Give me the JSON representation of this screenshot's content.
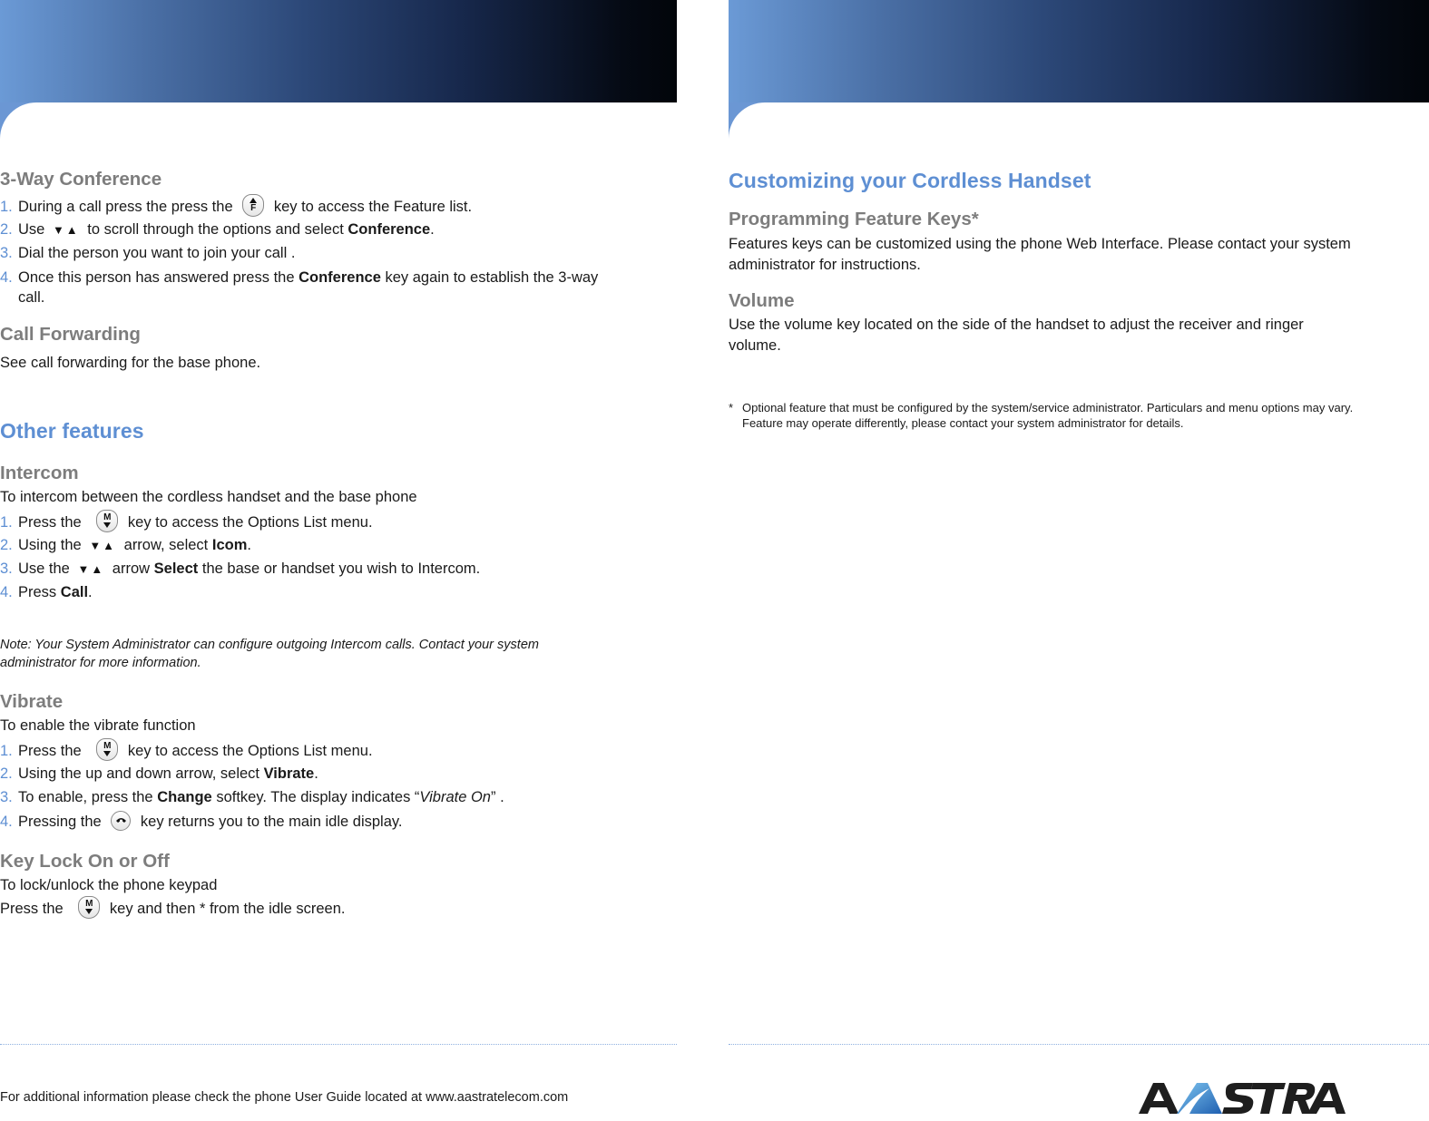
{
  "colors": {
    "accent": "#5e8fd3",
    "subheading": "#7d7d7d",
    "body": "#1a1a1a",
    "banner_start": "#6b9ad6",
    "banner_end": "#02050a"
  },
  "left": {
    "conference": {
      "title": "3-Way Conference",
      "steps": [
        {
          "num": "1.",
          "a": "During a call press the press the",
          "icon": "feature-key-icon",
          "icon_label": "F",
          "b": "key to access the Feature list."
        },
        {
          "num": "2.",
          "a": "Use",
          "arrows": "▼▲",
          "b": "to scroll through the options and select",
          "bold": "Conference",
          "c": "."
        },
        {
          "num": "3.",
          "a": "Dial the person you want to join your call ."
        },
        {
          "num": "4.",
          "a": "Once this person has answered press the",
          "bold": "Conference",
          "b": "key again to establish the 3-way",
          "cont": "call."
        }
      ]
    },
    "call_forwarding": {
      "title": "Call Forwarding",
      "text": "See call forwarding for the base phone."
    },
    "other_features": {
      "title": "Other features"
    },
    "intercom": {
      "title": "Intercom",
      "intro": "To intercom between the cordless handset and the base phone",
      "steps": [
        {
          "num": "1.",
          "a": "Press the",
          "icon": "menu-key-icon",
          "icon_label": "M",
          "b": "key to access the Options List menu."
        },
        {
          "num": "2.",
          "a": "Using the",
          "arrows": "▼▲",
          "b": "arrow, select",
          "bold": "Icom",
          "c": "."
        },
        {
          "num": "3.",
          "a": "Use the",
          "arrows": "▼▲",
          "b": "arrow",
          "bold": "Select",
          "c": "the base or handset you wish to Intercom."
        },
        {
          "num": "4.",
          "a": "Press",
          "bold": "Call",
          "c": "."
        }
      ],
      "note": "Note: Your System Administrator can configure outgoing Intercom calls. Contact your system administrator for more information."
    },
    "vibrate": {
      "title": "Vibrate",
      "intro": "To enable the vibrate function",
      "steps": [
        {
          "num": "1.",
          "a": "Press the",
          "icon": "menu-key-icon",
          "icon_label": "M",
          "b": "key to access the Options List menu."
        },
        {
          "num": "2.",
          "a": "Using the up and down arrow, select",
          "bold": "Vibrate",
          "c": "."
        },
        {
          "num": "3.",
          "a": "To enable, press the",
          "bold": "Change",
          "b": "softkey. The display indicates “",
          "italic": "Vibrate On",
          "c": "” ."
        },
        {
          "num": "4.",
          "a": "Pressing the",
          "icon": "end-call-key-icon",
          "b": "key returns you to the main idle display."
        }
      ]
    },
    "keylock": {
      "title": "Key Lock On or Off",
      "intro": "To lock/unlock the phone keypad",
      "line_a": "Press the",
      "icon_label": "M",
      "line_b": "key and then * from the idle screen."
    },
    "footer": "For additional information please check the phone User Guide located at www.aastratelecom.com"
  },
  "right": {
    "title": "Customizing your Cordless Handset",
    "programming": {
      "title": "Programming Feature Keys*",
      "text": "Features keys can be customized using the phone Web Interface. Please contact your system administrator for instructions."
    },
    "volume": {
      "title": "Volume",
      "text": "Use the volume key located on the side of the handset to adjust the receiver and ringer volume."
    },
    "footnote_mark": "*",
    "footnote": "Optional feature that must be configured by the system/service administrator. Particulars and menu options may vary. Feature may operate differently, please contact your system administrator for details.",
    "logo_text": "AASTRA"
  }
}
